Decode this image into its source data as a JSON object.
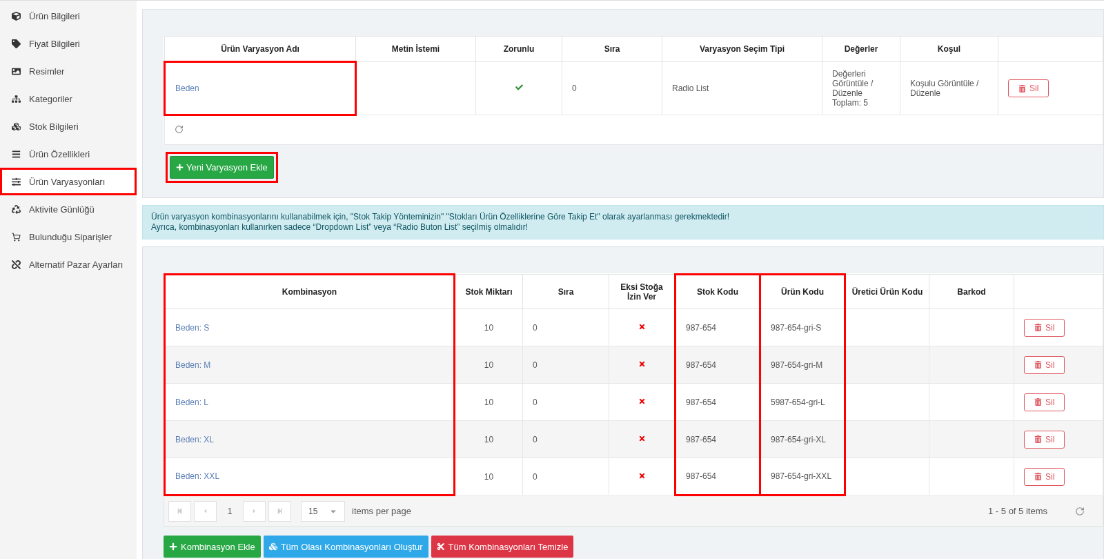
{
  "sidebar": {
    "items": [
      {
        "label": "Ürün Bilgileri",
        "selected": false
      },
      {
        "label": "Fiyat Bilgileri",
        "selected": false
      },
      {
        "label": "Resimler",
        "selected": false
      },
      {
        "label": "Kategoriler",
        "selected": false
      },
      {
        "label": "Stok Bilgileri",
        "selected": false
      },
      {
        "label": "Ürün Özellikleri",
        "selected": false
      },
      {
        "label": "Ürün Varyasyonları",
        "selected": true
      },
      {
        "label": "Aktivite Günlüğü",
        "selected": false
      },
      {
        "label": "Bulunduğu Siparişler",
        "selected": false
      },
      {
        "label": "Alternatif Pazar Ayarları",
        "selected": false
      }
    ]
  },
  "variations": {
    "columns": [
      "Ürün Varyasyon Adı",
      "Metin İstemi",
      "Zorunlu",
      "Sıra",
      "Varyasyon Seçim Tipi",
      "Değerler",
      "Koşul"
    ],
    "rows": [
      {
        "name": "Beden",
        "highlighted": true,
        "required": true,
        "order": "0",
        "type": "Radio List",
        "values_link": "Değerleri Görüntüle / Düzenle",
        "values_total": "Toplam: 5",
        "condition": "Koşulu Görüntüle / Düzenle",
        "delete": "Sil"
      }
    ],
    "add_button": {
      "label": "Yeni Varyasyon Ekle",
      "highlighted": true
    }
  },
  "notice": {
    "lines": [
      "Ürün varyasyon kombinasyonlarını kullanabilmek için, \"Stok Takip Yönteminizin\" \"Stokları Ürün Özelliklerine Göre Takip Et\" olarak ayarlanması gerekmektedir!",
      "Ayrıca, kombinasyonları kullanırken sadece “Dropdown List” veya “Radio Buton List” seçilmiş olmalıdır!"
    ]
  },
  "combinations": {
    "columns": [
      {
        "label": "Kombinasyon",
        "highlighted": true
      },
      {
        "label": "Stok Miktarı",
        "highlighted": false
      },
      {
        "label": "Sıra",
        "highlighted": false
      },
      {
        "label": "Eksi Stoğa İzin Ver",
        "highlighted": false
      },
      {
        "label": "Stok Kodu",
        "highlighted": true
      },
      {
        "label": "Ürün Kodu",
        "highlighted": true
      },
      {
        "label": "Üretici Ürün Kodu",
        "highlighted": false
      },
      {
        "label": "Barkod",
        "highlighted": false
      }
    ],
    "rows": [
      {
        "combination": "Beden: S",
        "stock": "10",
        "order": "0",
        "allow_negative": false,
        "stock_code": "987-654",
        "product_code": "987-654-gri-S",
        "delete": "Sil"
      },
      {
        "combination": "Beden: M",
        "stock": "10",
        "order": "0",
        "allow_negative": false,
        "stock_code": "987-654",
        "product_code": "987-654-gri-M",
        "delete": "Sil"
      },
      {
        "combination": "Beden: L",
        "stock": "10",
        "order": "0",
        "allow_negative": false,
        "stock_code": "987-654",
        "product_code": "5987-654-gri-L",
        "delete": "Sil"
      },
      {
        "combination": "Beden: XL",
        "stock": "10",
        "order": "0",
        "allow_negative": false,
        "stock_code": "987-654",
        "product_code": "987-654-gri-XL",
        "delete": "Sil"
      },
      {
        "combination": "Beden: XXL",
        "stock": "10",
        "order": "0",
        "allow_negative": false,
        "stock_code": "987-654",
        "product_code": "987-654-gri-XXL",
        "delete": "Sil"
      }
    ],
    "pager": {
      "page": "1",
      "page_size": "15",
      "per_page_label": "items per page",
      "summary": "1 - 5 of 5 items"
    },
    "actions": [
      {
        "label": "Kombinasyon Ekle",
        "kind": "add"
      },
      {
        "label": "Tüm Olası Kombinasyonları Oluştur",
        "kind": "generate"
      },
      {
        "label": "Tüm Kombinasyonları Temizle",
        "kind": "clear"
      }
    ]
  }
}
